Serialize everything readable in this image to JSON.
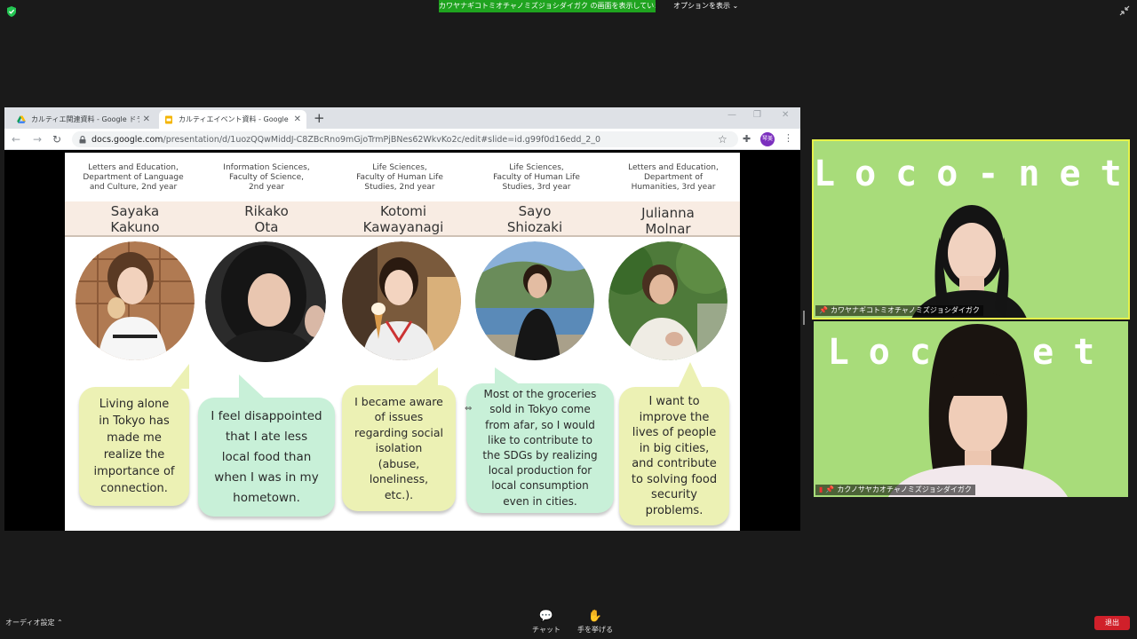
{
  "zoom": {
    "share_banner": "カワヤナギコトミオチャノミズジョシダイガク の画面を表示しています",
    "options_label": "オプションを表示 ⌄",
    "audio_label": "オーディオ設定 ⌃",
    "chat_label": "チャット",
    "raise_hand_label": "手を挙げる",
    "leave_label": "退出",
    "colors": {
      "banner": "#1fa31f",
      "leave": "#d0202a",
      "tile_bg": "#a8dc7a",
      "active_speaker": "#e6f24a"
    }
  },
  "browser": {
    "tabs": [
      {
        "label": "カルティエ関連資料 - Google ドライブ",
        "icon": "google-drive-icon"
      },
      {
        "label": "カルティエイベント資料 - Google スライド",
        "icon": "google-slides-icon",
        "active": true
      }
    ],
    "url_host": "docs.google.com",
    "url_path": "/presentation/d/1uozQQwMiddJ-C8ZBcRno9mGjoTrmPjBNes62WkvKo2c/edit#slide=id.g99f0d16edd_2_0",
    "profile_initials": "琴美"
  },
  "slide": {
    "people": [
      {
        "dept": "Letters and Education,\nDepartment of Language\nand Culture, 2nd year",
        "name": "Sayaka\nKakuno",
        "quote": "Living alone\nin Tokyo has\nmade me\nrealize the\nimportance of\nconnection."
      },
      {
        "dept": "Information Sciences,\nFaculty of Science,\n2nd year",
        "name": "Rikako\nOta",
        "quote": "I feel disappointed\nthat I ate less\nlocal food than\nwhen I was in my\nhometown."
      },
      {
        "dept": "Life Sciences,\nFaculty of Human Life\nStudies, 2nd year",
        "name": "Kotomi\nKawayanagi",
        "quote": "I became aware\nof issues\nregarding social\nisolation\n(abuse,\nloneliness,\netc.)."
      },
      {
        "dept": "Life Sciences,\nFaculty of Human Life\nStudies, 3rd year",
        "name": "Sayo\nShiozaki",
        "quote": "Most of the groceries\nsold in Tokyo come\nfrom afar, so I would\nlike to contribute to\nthe SDGs by realizing\nlocal production for\nlocal consumption\neven in cities."
      },
      {
        "dept": "Letters and Education,\nDepartment of\nHumanities, 3rd year",
        "name": "Julianna\nMolnar",
        "quote": "I want to\nimprove the\nlives of people\nin big cities,\nand contribute\nto solving food\nsecurity\nproblems."
      }
    ],
    "colors": {
      "name_band": "#f8ece3",
      "bubble_yellow": "#ecf1b4",
      "bubble_green": "#c8f0d8"
    }
  },
  "video": {
    "tiles": [
      {
        "logo": "Loco-net",
        "name": "カワヤナギコトミオチャノミズジョシダイガク"
      },
      {
        "logo": "Loco   et",
        "name": "カクノサヤカオチャノミズジョシダイガク"
      }
    ]
  }
}
